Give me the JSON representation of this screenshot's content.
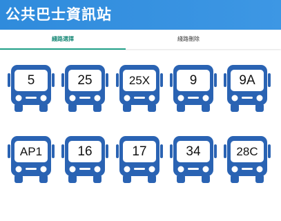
{
  "app": {
    "title": "公共巴士資訊站"
  },
  "tabs": [
    {
      "label": "綫路選擇",
      "active": true
    },
    {
      "label": "綫路刪除",
      "active": false
    }
  ],
  "routes": [
    "5",
    "25",
    "25X",
    "9",
    "9A",
    "AP1",
    "16",
    "17",
    "34",
    "28C"
  ],
  "colors": {
    "header": "#3490df",
    "bus": "#2a63b3",
    "tab_accent": "#20a088"
  },
  "icons": {
    "route": "bus-front-icon"
  }
}
